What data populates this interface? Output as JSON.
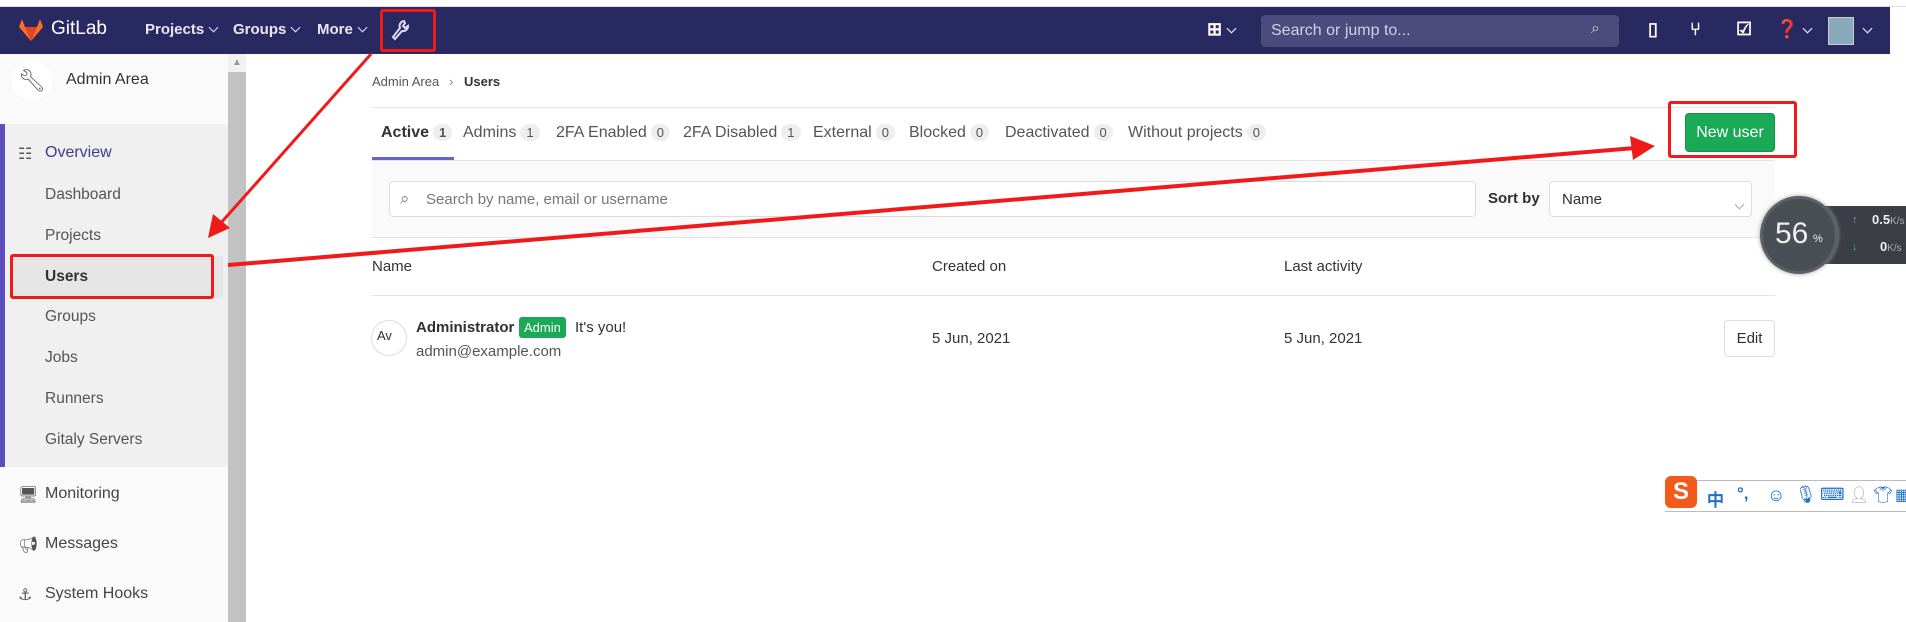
{
  "navbar": {
    "brand": "GitLab",
    "projects": "Projects",
    "groups": "Groups",
    "more": "More",
    "search_placeholder": "Search or jump to...",
    "brand_color": "#292961"
  },
  "sidebar": {
    "title": "Admin Area",
    "overview": "Overview",
    "items": [
      {
        "label": "Dashboard"
      },
      {
        "label": "Projects"
      },
      {
        "label": "Users"
      },
      {
        "label": "Groups"
      },
      {
        "label": "Jobs"
      },
      {
        "label": "Runners"
      },
      {
        "label": "Gitaly Servers"
      }
    ],
    "sections": [
      {
        "label": "Monitoring"
      },
      {
        "label": "Messages"
      },
      {
        "label": "System Hooks"
      }
    ]
  },
  "breadcrumb": {
    "parent": "Admin Area",
    "current": "Users"
  },
  "tabs": [
    {
      "label": "Active",
      "count": "1"
    },
    {
      "label": "Admins",
      "count": "1"
    },
    {
      "label": "2FA Enabled",
      "count": "0"
    },
    {
      "label": "2FA Disabled",
      "count": "1"
    },
    {
      "label": "External",
      "count": "0"
    },
    {
      "label": "Blocked",
      "count": "0"
    },
    {
      "label": "Deactivated",
      "count": "0"
    },
    {
      "label": "Without projects",
      "count": "0"
    }
  ],
  "new_user_label": "New user",
  "filter": {
    "search_placeholder": "Search by name, email or username",
    "sort_label": "Sort by",
    "sort_value": "Name"
  },
  "table": {
    "headers": [
      "Name",
      "Created on",
      "Last activity"
    ],
    "rows": [
      {
        "avatar_alt": "Av",
        "name": "Administrator",
        "badge": "Admin",
        "note": "It's you!",
        "email": "admin@example.com",
        "created": "5 Jun, 2021",
        "last_activity": "5 Jun, 2021",
        "action": "Edit"
      }
    ]
  },
  "widget": {
    "percent": "56",
    "percent_sign": "%",
    "up": "0.5",
    "down": "0",
    "unit": "K/s"
  },
  "ime": {
    "lang": "中",
    "punct": "°,"
  }
}
